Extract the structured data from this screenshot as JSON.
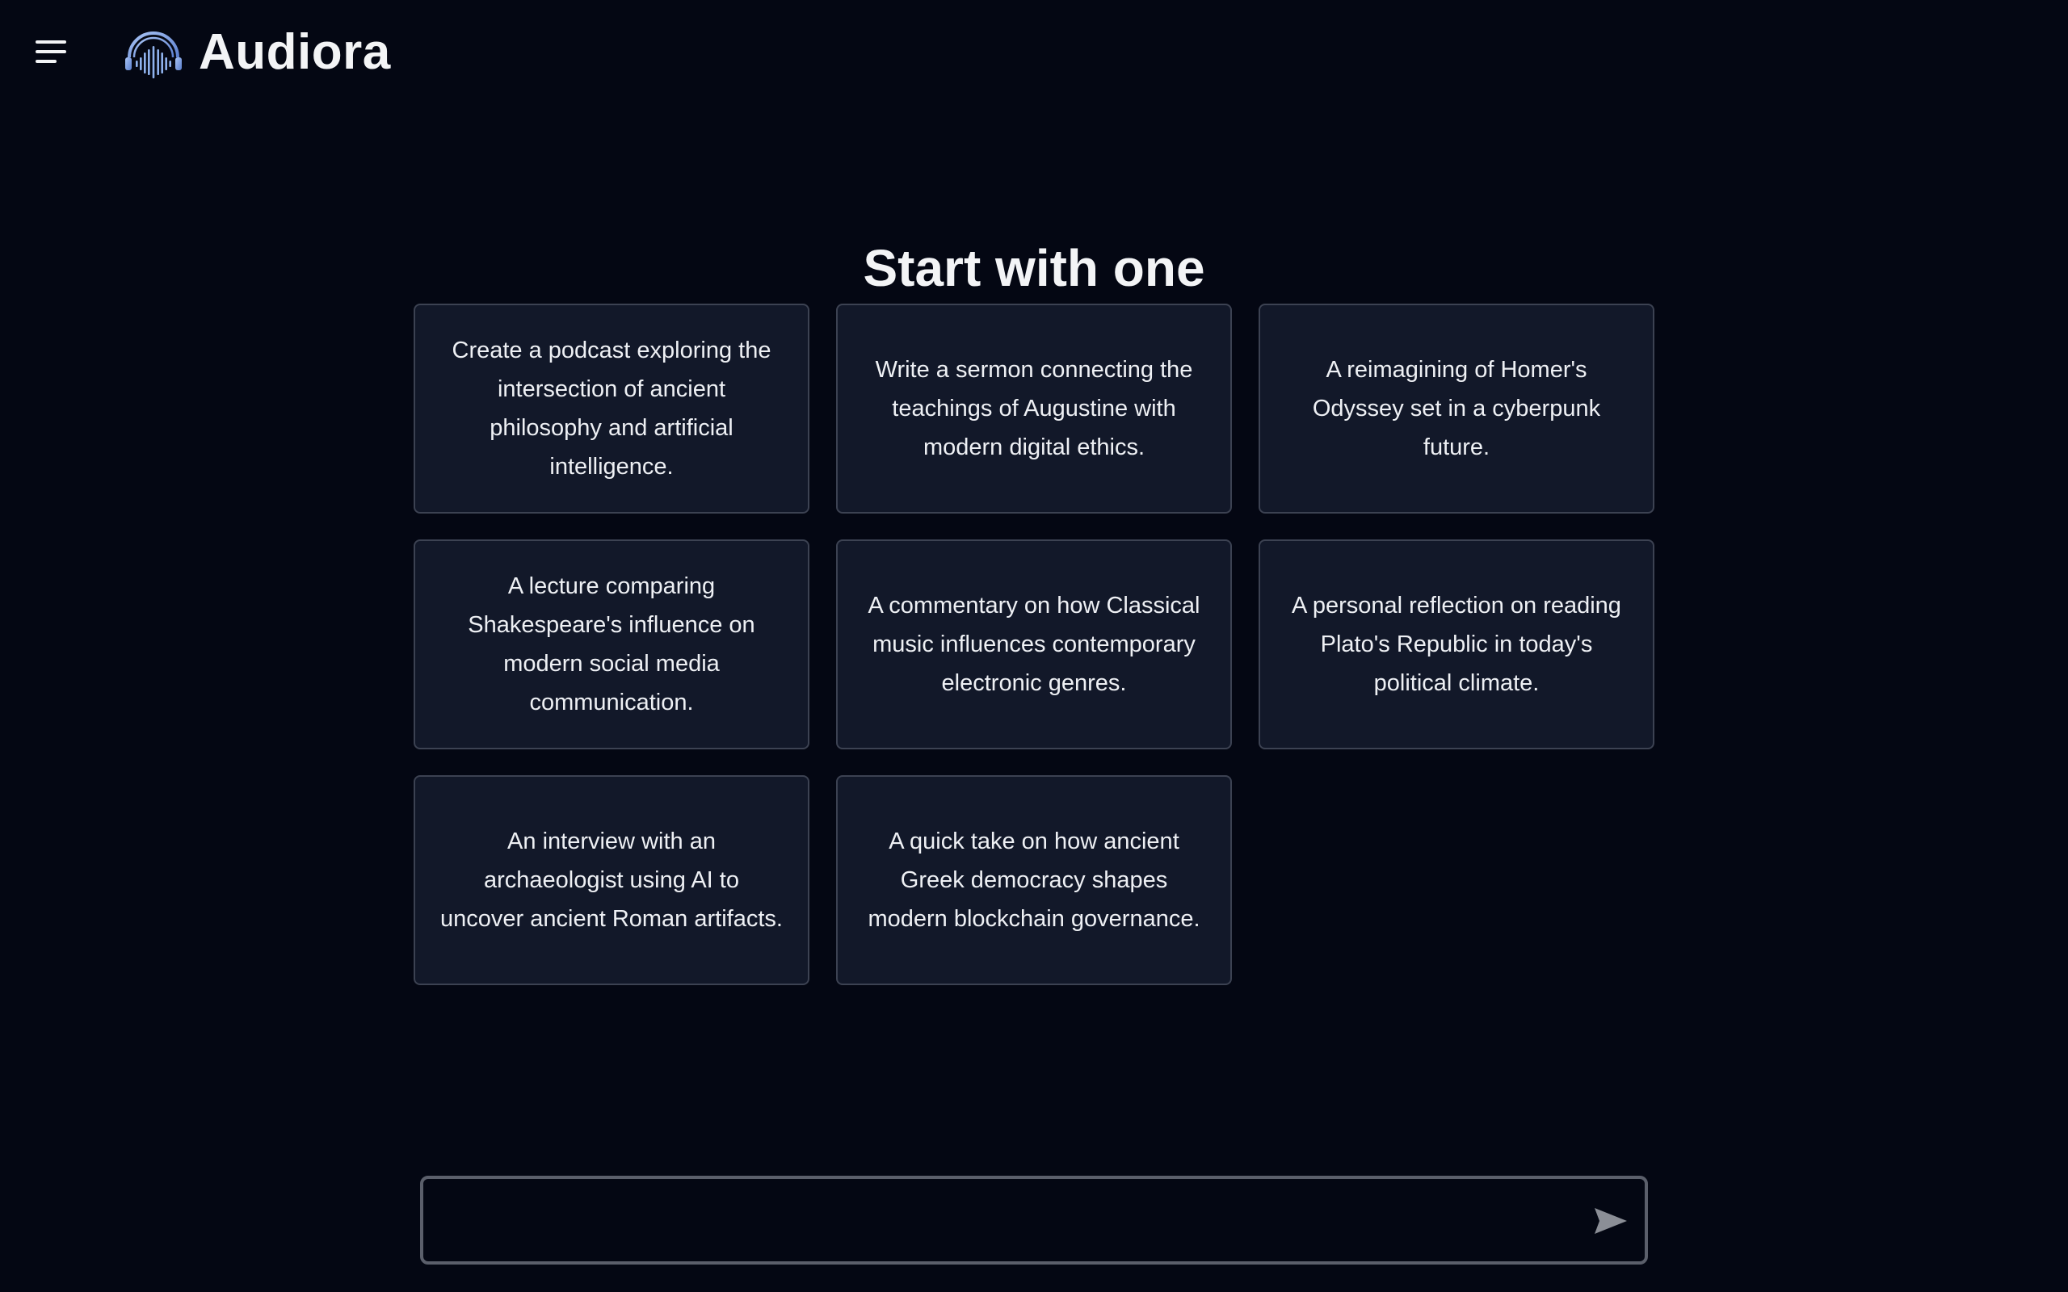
{
  "header": {
    "brand_name": "Audiora",
    "logo_icon": "headphones-soundwave-icon",
    "menu_icon": "hamburger-menu-icon",
    "accent_color": "#8fb2ee"
  },
  "main": {
    "heading": "Start with one",
    "suggestions": [
      "Create a podcast exploring the intersection of ancient philosophy and artificial intelligence.",
      "Write a sermon connecting the teachings of Augustine with modern digital ethics.",
      "A reimagining of Homer's Odyssey set in a cyberpunk future.",
      "A lecture comparing Shakespeare's influence on modern social media communication.",
      "A commentary on how Classical music influences contemporary electronic genres.",
      "A personal reflection on reading Plato's Republic in today's political climate.",
      "An interview with an archaeologist using AI to uncover ancient Roman artifacts.",
      "A quick take on how ancient Greek democracy shapes modern blockchain governance."
    ]
  },
  "composer": {
    "value": "",
    "placeholder": "",
    "send_icon": "send-icon"
  }
}
